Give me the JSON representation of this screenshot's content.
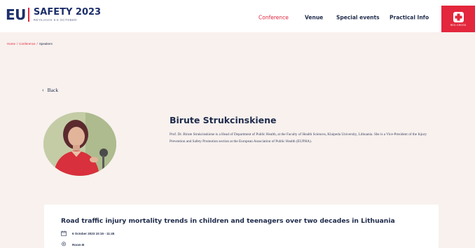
{
  "header": {
    "logo": {
      "eu": "EU",
      "title": "SAFETY 2023",
      "subtitle": "REYKJAVIK 5-6 OCTOBER"
    },
    "nav": [
      {
        "label": "Conference",
        "active": true
      },
      {
        "label": "Venue",
        "active": false
      },
      {
        "label": "Special events",
        "active": false
      },
      {
        "label": "Practical Info",
        "active": false
      }
    ],
    "partner": {
      "label": "RED CROSS",
      "icon": "red-cross-icon",
      "color": "#e3273d"
    }
  },
  "breadcrumb": {
    "items": [
      "Home",
      "Conference",
      "Speakers"
    ],
    "separator": "/"
  },
  "back": {
    "label": "Back",
    "icon": "chevron-left-icon"
  },
  "speaker": {
    "name": "Birute Strukcinskiene",
    "bio": "Prof. Dr. Birute Strukcinskiene is a Head of Department of Public Health, at the Faculty of Health Sciences, Klaipeda University, Lithuania. She is a Vice-President of the Injury Prevention and Safety Promotion section at the European Association of Public Health (EUPHA).",
    "photo_icon": "speaker-photo"
  },
  "session": {
    "title": "Road traffic injury mortality trends in children and teenagers over two decades in Lithuania",
    "datetime": "6 October 2023 10:15 - 11:45",
    "room": "Room B",
    "datetime_icon": "calendar-icon",
    "room_icon": "location-pin-icon"
  },
  "colors": {
    "accent": "#e3273d",
    "navy": "#1e2a4a",
    "background": "#f8f1ee"
  }
}
